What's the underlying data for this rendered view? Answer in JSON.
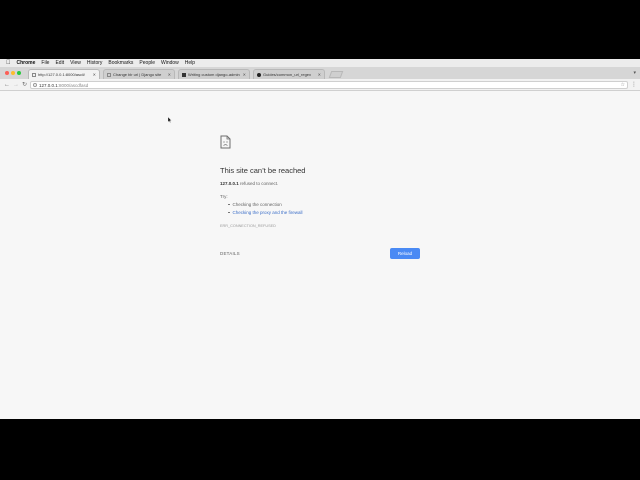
{
  "menubar": {
    "items": [
      "Chrome",
      "File",
      "Edit",
      "View",
      "History",
      "Bookmarks",
      "People",
      "Window",
      "Help"
    ]
  },
  "tabs": [
    {
      "title": "http://127.0.0.1:8000/ascii/",
      "active": true
    },
    {
      "title": "Change blr url | Django site"
    },
    {
      "title": "Writing custom django-admin"
    },
    {
      "title": "Guides/common_url_regex"
    }
  ],
  "toolbar": {
    "url_host": "127.0.0.1",
    "url_rest": ":8000/ascdfasd"
  },
  "error": {
    "title": "This site can’t be reached",
    "host": "127.0.0.1",
    "message": " refused to connect.",
    "try_label": "Try:",
    "suggestions": [
      "Checking the connection",
      "Checking the proxy and the firewall"
    ],
    "code": "ERR_CONNECTION_REFUSED",
    "details_label": "DETAILS",
    "reload_label": "Reload"
  },
  "colors": {
    "accent": "#4a8af4",
    "link": "#3b6ec8",
    "page_bg": "#f7f7f7",
    "close_dot": "#fc5f57",
    "minimize_dot": "#fdbc2e",
    "zoom_dot": "#28c840"
  }
}
